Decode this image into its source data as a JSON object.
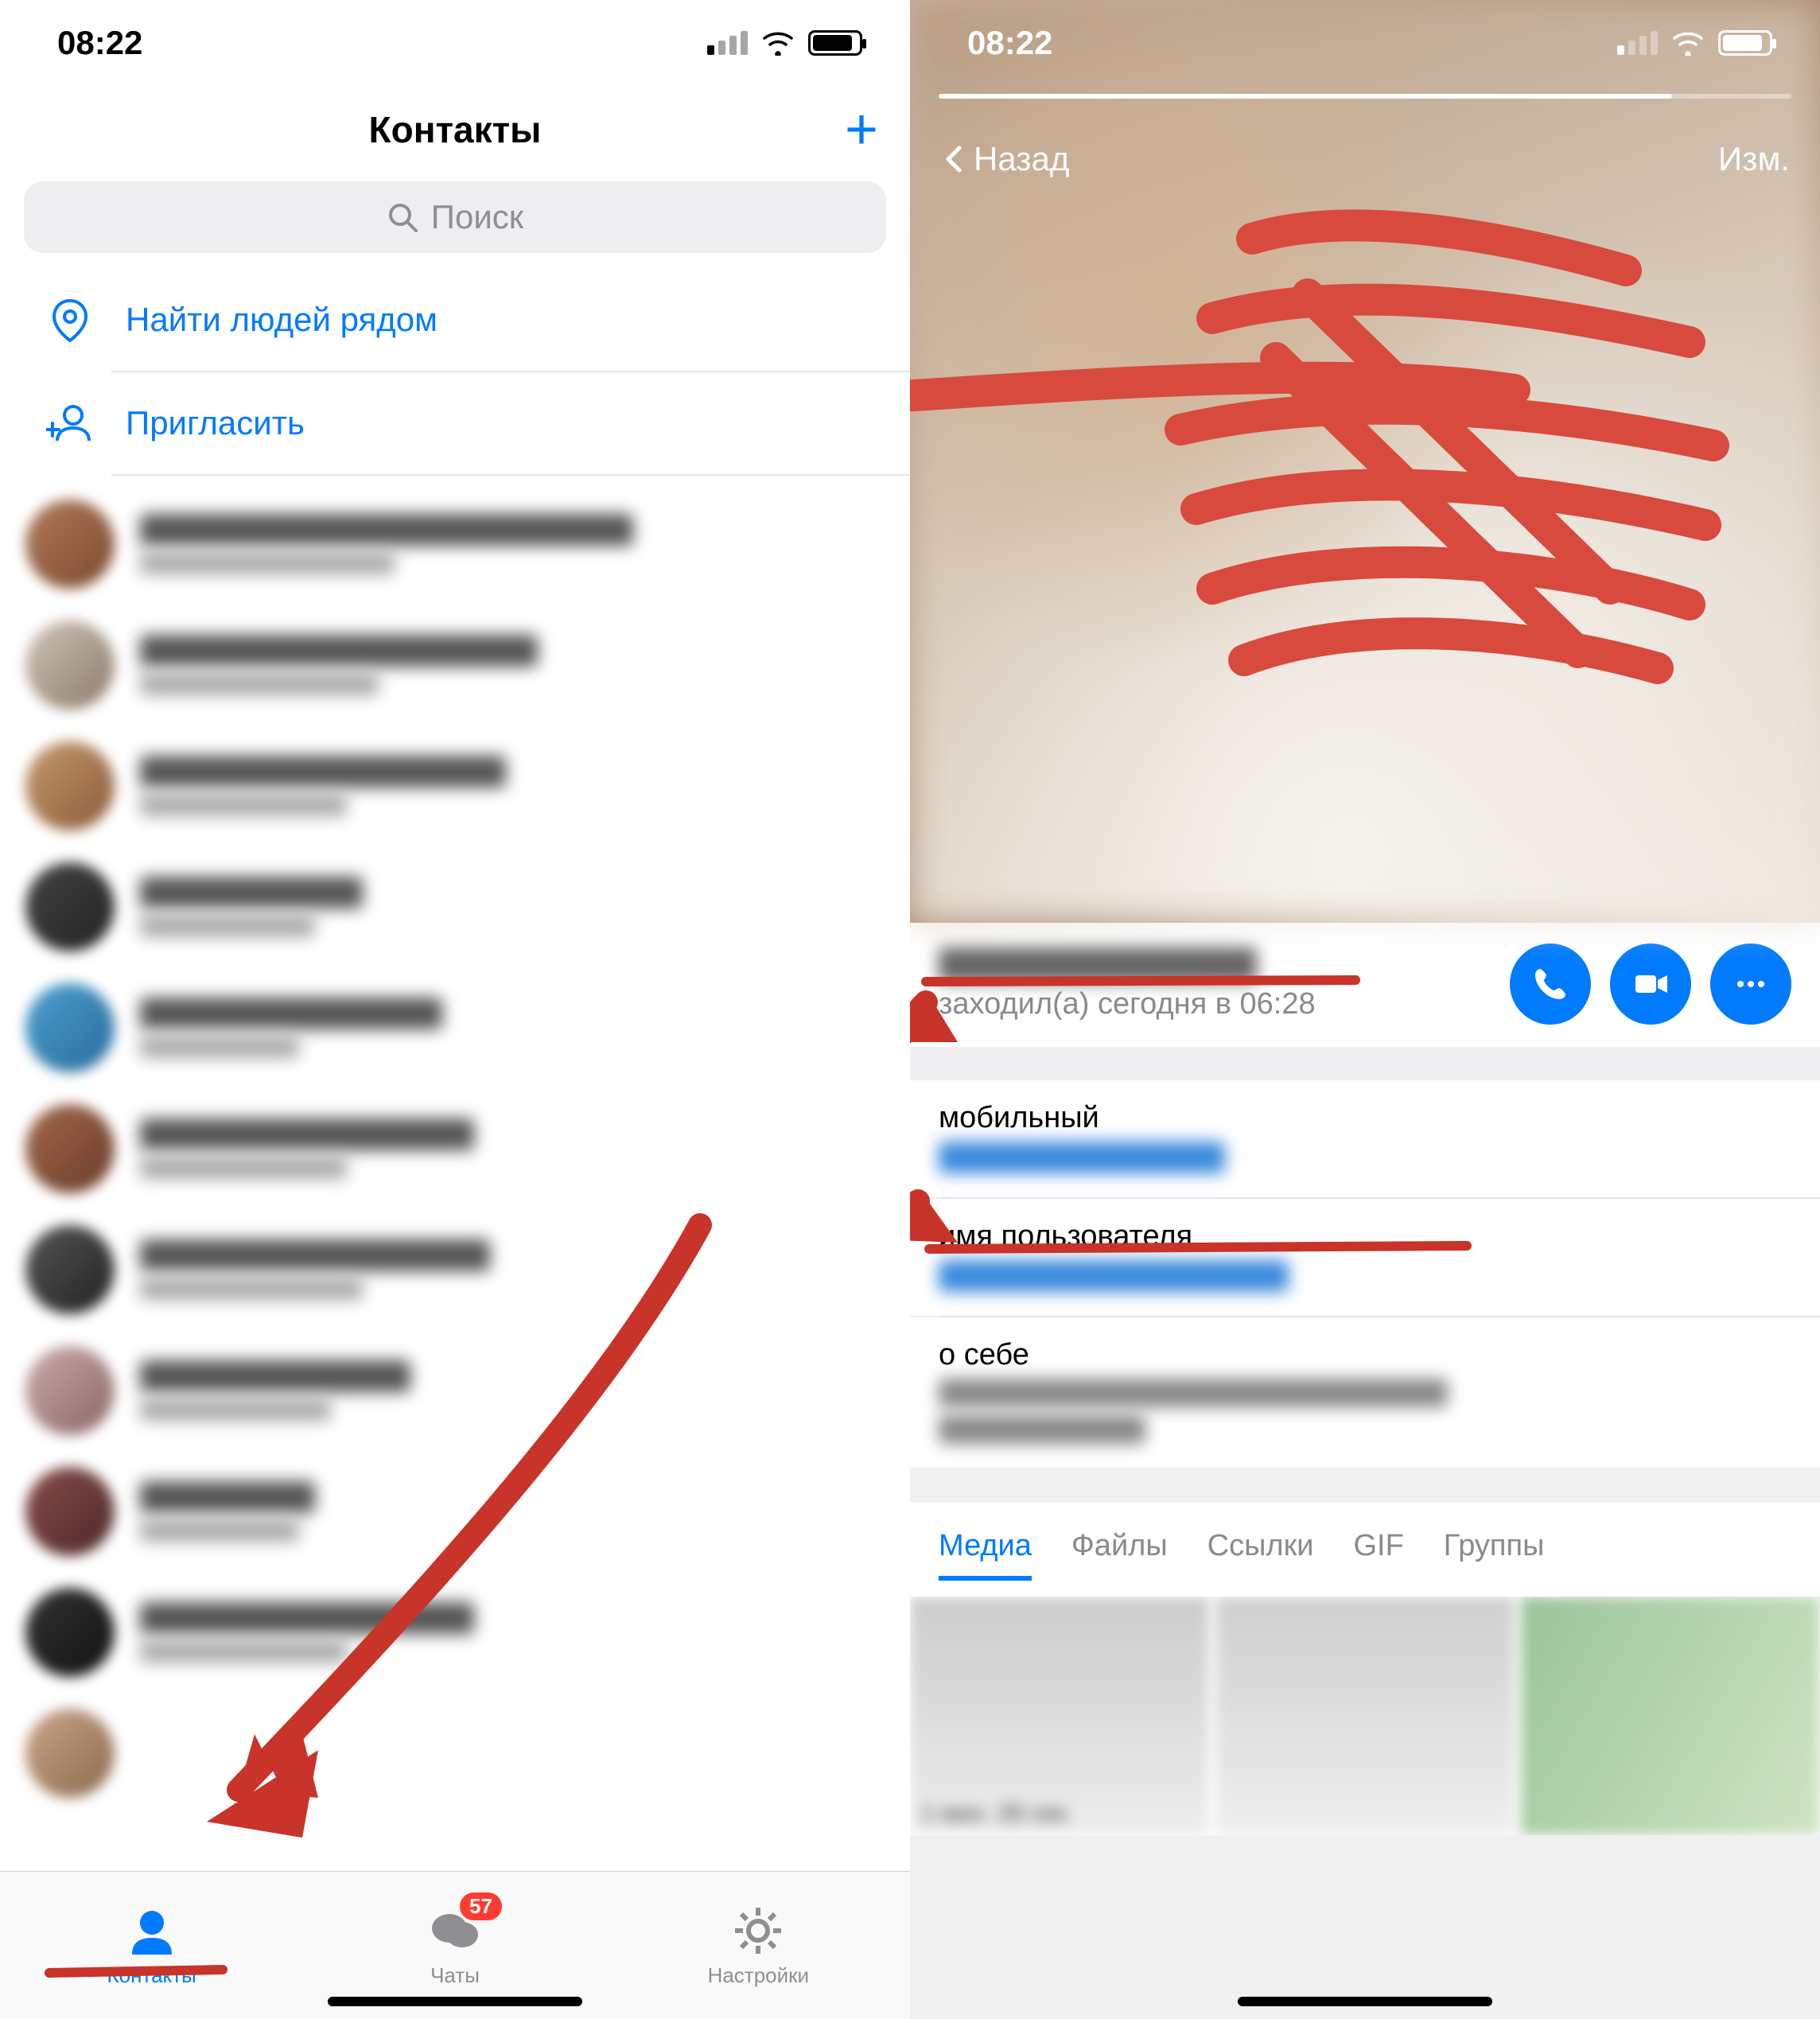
{
  "left": {
    "status_time": "08:22",
    "title": "Контакты",
    "search_placeholder": "Поиск",
    "nearby": "Найти людей рядом",
    "invite": "Пригласить",
    "tabs": {
      "contacts": "Контакты",
      "chats": "Чаты",
      "settings": "Настройки",
      "chats_badge": "57"
    }
  },
  "right": {
    "status_time": "08:22",
    "back": "Назад",
    "edit": "Изм.",
    "last_seen": "заходил(а) сегодня в 06:28",
    "mobile_label": "мобильный",
    "username_label": "имя пользователя",
    "bio_label": "о себе",
    "tabs": {
      "media": "Медиа",
      "files": "Файлы",
      "links": "Ссылки",
      "gif": "GIF",
      "groups": "Группы"
    },
    "media_caption": "1 мин. 26 сек."
  }
}
